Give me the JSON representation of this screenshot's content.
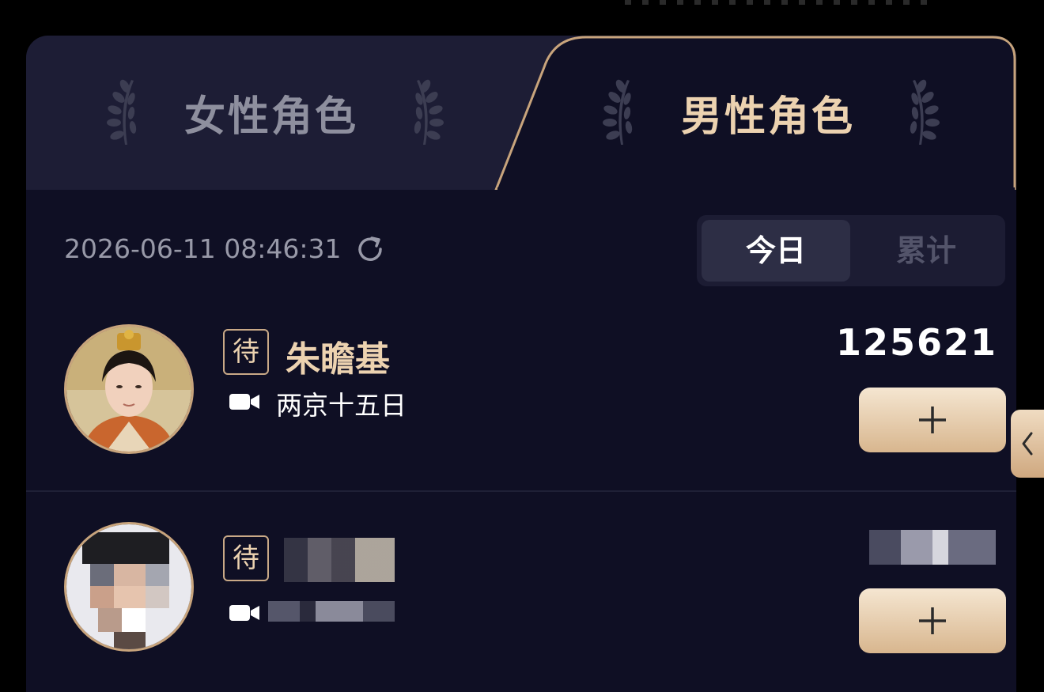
{
  "tabs": [
    {
      "label": "女性角色",
      "active": false
    },
    {
      "label": "男性角色",
      "active": true
    }
  ],
  "header": {
    "timestamp": "2026-06-11 08:46:31",
    "segment": {
      "options": [
        "今日",
        "累计"
      ],
      "selected": "今日"
    }
  },
  "rows": [
    {
      "tag": "待",
      "name": "朱瞻基",
      "drama": "两京十五日",
      "score": "125621",
      "add_icon": "plus-icon"
    },
    {
      "tag": "待",
      "name": "",
      "drama": "",
      "score": "",
      "add_icon": "plus-icon"
    }
  ],
  "colors": {
    "background": "#0f0f24",
    "accent_gold": "#ecd2b0",
    "button_gradient_top": "#f5e6d1",
    "button_gradient_bottom": "#d8b68e"
  },
  "icons": [
    "laurel-icon",
    "refresh-icon",
    "video-camera-icon",
    "plus-icon",
    "chevron-left-icon"
  ]
}
